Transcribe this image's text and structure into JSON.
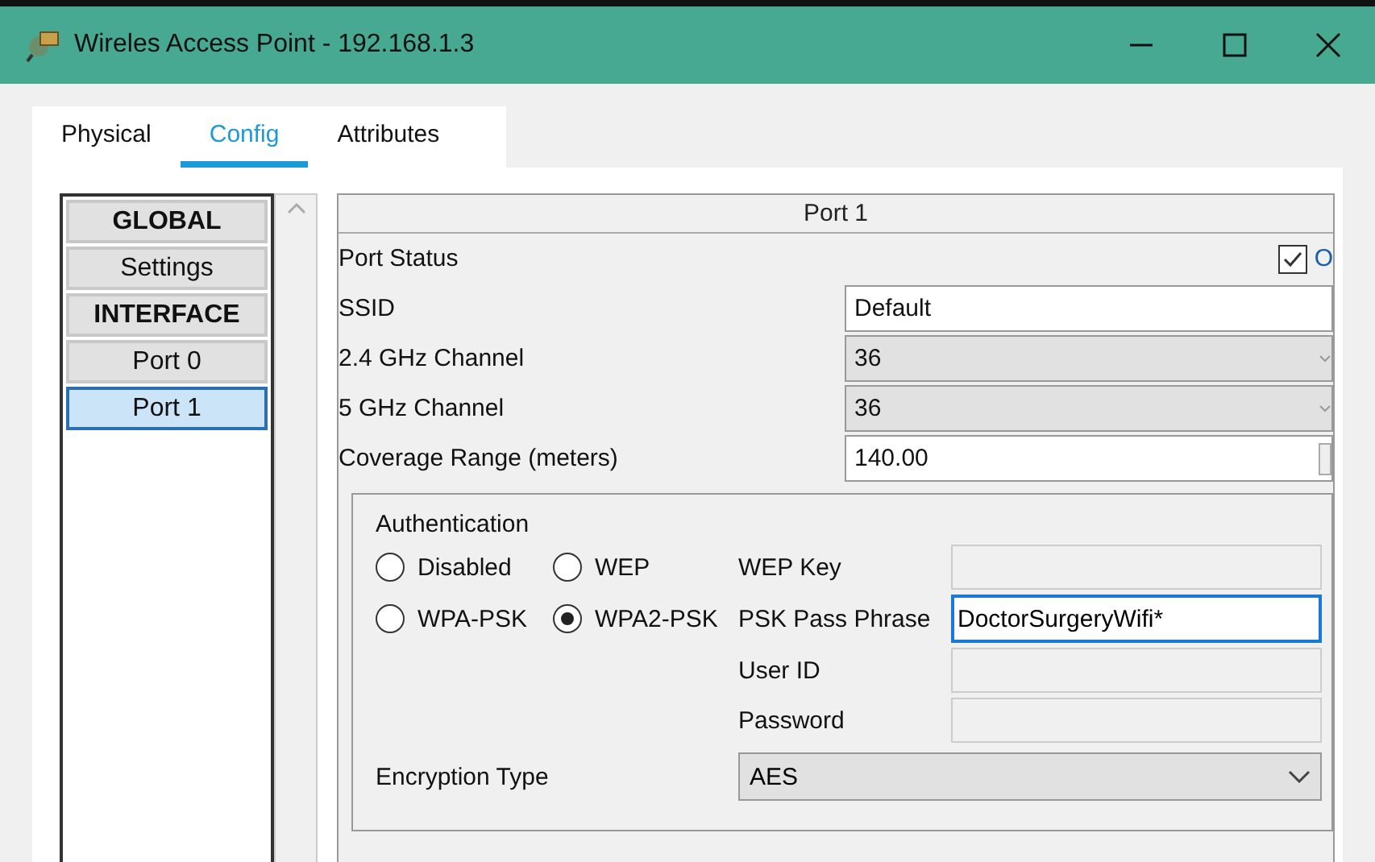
{
  "window": {
    "title": "Wireles Access Point - 192.168.1.3"
  },
  "tabs": [
    {
      "label": "Physical",
      "selected": false
    },
    {
      "label": "Config",
      "selected": true
    },
    {
      "label": "Attributes",
      "selected": false
    }
  ],
  "sidebar": {
    "items": [
      {
        "label": "GLOBAL",
        "kind": "header",
        "selected": false
      },
      {
        "label": "Settings",
        "kind": "item",
        "selected": false
      },
      {
        "label": "INTERFACE",
        "kind": "header",
        "selected": false
      },
      {
        "label": "Port 0",
        "kind": "item",
        "selected": false
      },
      {
        "label": "Port 1",
        "kind": "item",
        "selected": true
      }
    ]
  },
  "panel": {
    "title": "Port 1",
    "port_status": {
      "label": "Port Status",
      "checked": true,
      "text": "O"
    },
    "fields": [
      {
        "label": "SSID",
        "kind": "text",
        "value": "Default"
      },
      {
        "label": "2.4 GHz Channel",
        "kind": "select",
        "value": "36"
      },
      {
        "label": "5 GHz Channel",
        "kind": "select",
        "value": "36"
      },
      {
        "label": "Coverage Range (meters)",
        "kind": "spin",
        "value": "140.00"
      }
    ],
    "authentication": {
      "title": "Authentication",
      "options": [
        {
          "label": "Disabled",
          "selected": false
        },
        {
          "label": "WEP",
          "selected": false
        },
        {
          "label": "WPA-PSK",
          "selected": false
        },
        {
          "label": "WPA2-PSK",
          "selected": true
        }
      ],
      "fields": [
        {
          "label": "WEP Key",
          "disabled": true
        },
        {
          "label": "PSK Pass Phrase",
          "value": "DoctorSurgeryWifi*",
          "disabled": false
        },
        {
          "label": "User ID",
          "disabled": true
        },
        {
          "label": "Password",
          "disabled": true
        }
      ],
      "encryption": {
        "label": "Encryption Type",
        "value": "AES"
      }
    }
  }
}
